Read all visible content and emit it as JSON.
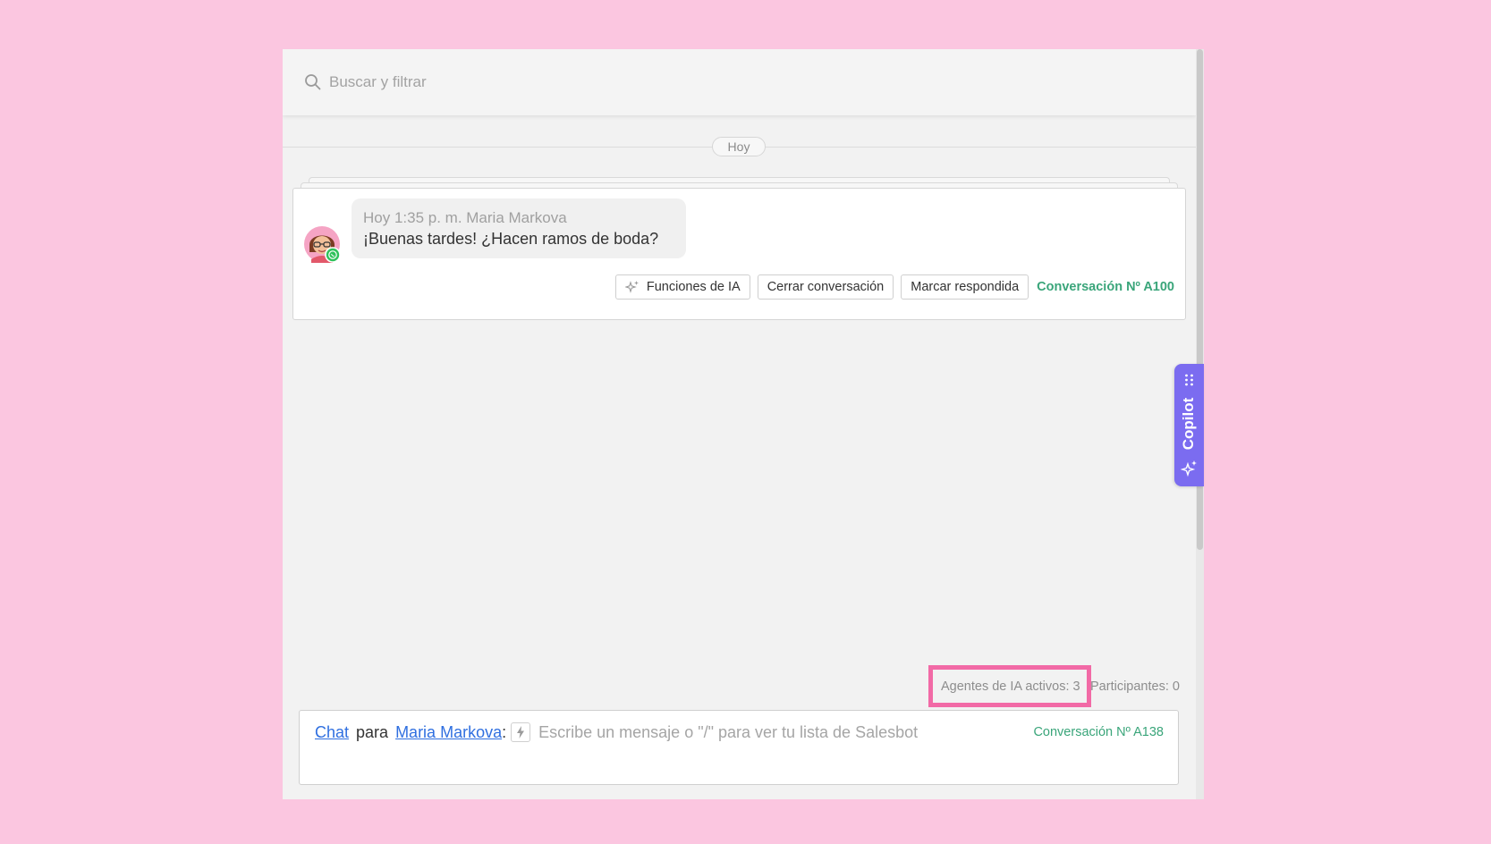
{
  "search": {
    "placeholder": "Buscar y filtrar"
  },
  "feed": {
    "date_label": "Hoy"
  },
  "message": {
    "meta": "Hoy 1:35 p. m. Maria Markova",
    "text": "¡Buenas tardes! ¿Hacen ramos de boda?",
    "actions": {
      "ai_label": "Funciones de IA",
      "close_label": "Cerrar conversación",
      "mark_label": "Marcar respondida",
      "conversation": "Conversación Nº A100"
    }
  },
  "copilot": {
    "label": "Copilot"
  },
  "status": {
    "ai_agents": "Agentes de IA activos: 3",
    "participants": "Participantes: 0"
  },
  "composer": {
    "channel": "Chat",
    "connector": "para",
    "recipient": "Maria Markova",
    "colon": ":",
    "placeholder": "Escribe un mensaje o \"/\" para ver tu lista de Salesbot",
    "conversation": "Conversación Nº A138"
  },
  "colors": {
    "page_background": "#fbc6e0",
    "accent_green": "#3aa57a",
    "copilot_purple": "#7b6cf0",
    "highlight_pink": "#f26aa6",
    "link_blue": "#2f6fe0"
  },
  "icons": [
    "search-icon",
    "sparkle-icon",
    "whatsapp-icon",
    "drag-handle-icon",
    "bolt-icon"
  ]
}
